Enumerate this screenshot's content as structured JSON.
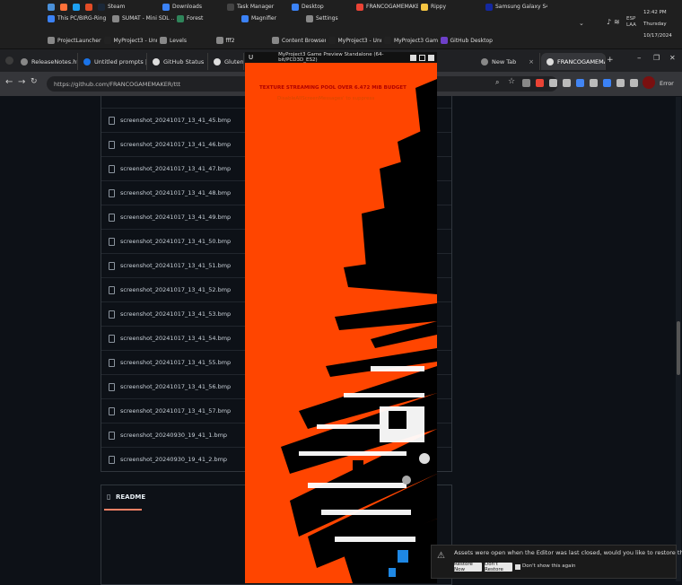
{
  "taskbar": {
    "row1": [
      {
        "label": "",
        "color": "#4a90d9"
      },
      {
        "label": "",
        "color": "#ff7139"
      },
      {
        "label": "",
        "color": "#1da1f2"
      },
      {
        "label": "",
        "color": "#e34c26"
      },
      {
        "label": "Steam",
        "color": "#1b2838"
      },
      {
        "label": "Downloads",
        "color": "#3b82f6"
      },
      {
        "label": "Task Manager",
        "color": "#444"
      },
      {
        "label": "Desktop",
        "color": "#3b82f6"
      },
      {
        "label": "FRANCOGAMEMAKE...",
        "color": "#ea4335"
      },
      {
        "label": "Rippy",
        "color": "#f5c542"
      },
      {
        "label": "Samsung Galaxy S4 M...",
        "color": "#1428a0"
      },
      {
        "label": "This PC/BIRG-Ring",
        "color": "#3b82f6"
      },
      {
        "label": "SUMAT - Mini SDL ...",
        "color": "#888"
      },
      {
        "label": "Forest",
        "color": "#2f855a"
      },
      {
        "label": "Magnifier",
        "color": "#3b82f6"
      },
      {
        "label": "Settings",
        "color": "#888"
      }
    ],
    "row2": [
      {
        "label": "ProjectLauncher",
        "color": "#888"
      },
      {
        "label": "MyProject3 - Unreal E...",
        "color": "#222"
      },
      {
        "label": "Levels",
        "color": "#888"
      },
      {
        "label": "fff2",
        "color": "#888"
      },
      {
        "label": "Content Browser",
        "color": "#888"
      },
      {
        "label": "MyProject3 - Unreal E...",
        "color": "#222"
      },
      {
        "label": "MyProject3 Game Pre...",
        "color": "#222"
      },
      {
        "label": "GitHub Desktop",
        "color": "#6e40c9"
      }
    ],
    "tray": {
      "time": "12:42 PM",
      "day": "Thursday",
      "date": "10/17/2024",
      "lang1": "ESP",
      "lang2": "LAA"
    }
  },
  "tabs": [
    {
      "label": "ReleaseNotes.html",
      "color": "#888"
    },
    {
      "label": "Untitled prompts | G",
      "color": "#1a73e8"
    },
    {
      "label": "GitHub Status",
      "color": "#ddd"
    },
    {
      "label": "Gluten and",
      "color": "#ddd"
    },
    {
      "label": "New Tab",
      "color": "#888"
    },
    {
      "label": "FRANCOGAMEMAKER",
      "color": "#ddd"
    }
  ],
  "browser": {
    "url": "https://github.com/FRANCOGAMEMAKER/ttt",
    "error_label": "Error"
  },
  "files": [
    "screenshot_20241017_13_41_45.bmp",
    "screenshot_20241017_13_41_46.bmp",
    "screenshot_20241017_13_41_47.bmp",
    "screenshot_20241017_13_41_48.bmp",
    "screenshot_20241017_13_41_49.bmp",
    "screenshot_20241017_13_41_50.bmp",
    "screenshot_20241017_13_41_51.bmp",
    "screenshot_20241017_13_41_52.bmp",
    "screenshot_20241017_13_41_53.bmp",
    "screenshot_20241017_13_41_54.bmp",
    "screenshot_20241017_13_41_55.bmp",
    "screenshot_20241017_13_41_56.bmp",
    "screenshot_20241017_13_41_57.bmp",
    "screenshot_20240930_19_41_1.bmp",
    "screenshot_20240930_19_41_2.bmp"
  ],
  "readme_label": "README",
  "game": {
    "title": "MyProject3 Game Preview Standalone (64-bit/PCD3D_ES2)",
    "warning": "TEXTURE STREAMING POOL OVER 6.472 MiB BUDGET",
    "subwarning": "DisableAllScreenMessages' to suppress",
    "bg": "#ff4500"
  },
  "toast": {
    "message": "Assets were open when the Editor was last closed, would you like to restore them now?",
    "restore": "Restore Now",
    "dont_restore": "Don't Restore",
    "dont_show": "Don't show this again"
  }
}
